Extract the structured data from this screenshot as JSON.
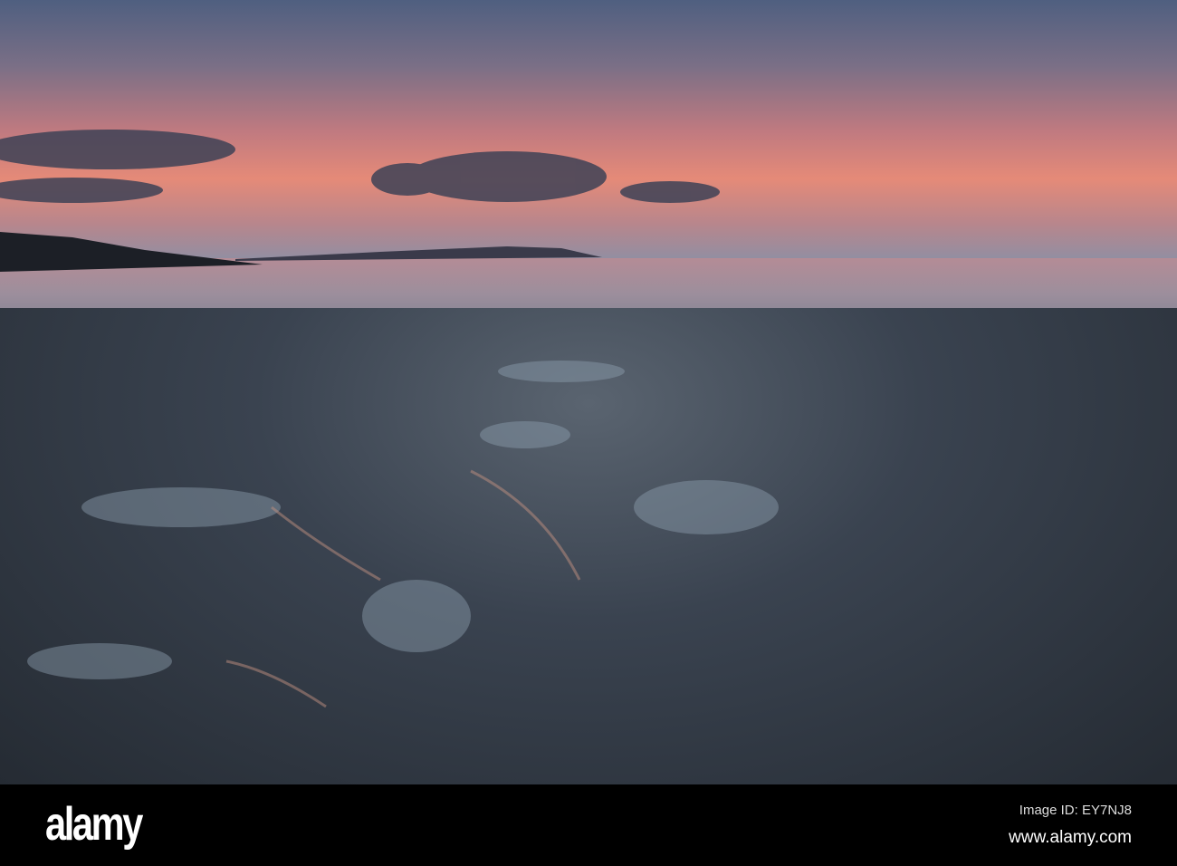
{
  "photo": {
    "subject": "rocky shoreline at sunset",
    "watermark": "alamy"
  },
  "footer": {
    "logo": "alamy",
    "image_id": "Image ID: EY7NJ8",
    "url": "www.alamy.com"
  }
}
